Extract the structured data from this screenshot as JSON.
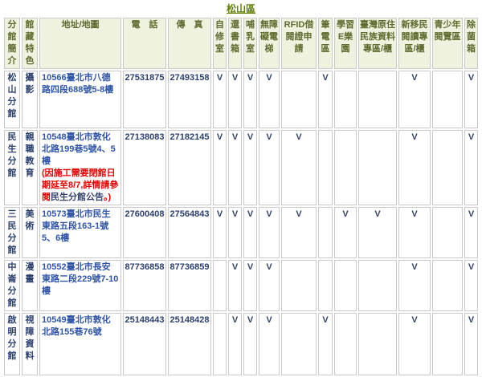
{
  "title": {
    "text": "松山區"
  },
  "colors": {
    "title_green": "#5e7d00",
    "header_bg": "#f0f2e0",
    "header_text": "#5d6b2e",
    "body_text_navy": "#2c406f",
    "address_link_blue": "#2f55a8",
    "notice_red": "#e60000",
    "grid_border": "#c9c9c9"
  },
  "table": {
    "headers": {
      "branch": "分館簡介",
      "feature": "館藏特色",
      "address": "地址/地圖",
      "phone": "電　話",
      "fax": "傳　真",
      "amenities": [
        "自修室",
        "還書箱",
        "哺乳室",
        "無障礙電梯",
        "RFID借閱證申請",
        "筆電區",
        "學習E樂園",
        "臺灣原住民族資料專區/櫃",
        "新移民閱讀專區/櫃",
        "青少年閱覽區",
        "除菌箱"
      ]
    },
    "rows": [
      {
        "branch": "松山分館",
        "feature": "攝影",
        "address": "10566臺北市八德路四段688號5-8樓",
        "phone": "27531875",
        "fax": "27493158",
        "marks": [
          "V",
          "V",
          "V",
          "V",
          "",
          "V",
          "",
          "",
          "V",
          "",
          "V"
        ]
      },
      {
        "branch": "民生分館",
        "feature": "親職教育",
        "address": "10548臺北市敦化北路199巷5號4、5樓",
        "note": {
          "prefix": "(因施工需要閉館日期延至8/7,詳情請參閱",
          "link": "民生分館公告",
          "suffix": "。)"
        },
        "phone": "27138083",
        "fax": "27182145",
        "marks": [
          "V",
          "V",
          "V",
          "V",
          "V",
          "",
          "",
          "",
          "V",
          "",
          "V"
        ]
      },
      {
        "branch": "三民分館",
        "feature": "美術",
        "address": "10573臺北市民生東路五段163-1號5、6樓",
        "phone": "27600408",
        "fax": "27564843",
        "marks": [
          "V",
          "V",
          "V",
          "V",
          "V",
          "",
          "V",
          "V",
          "V",
          "",
          "V"
        ]
      },
      {
        "branch": "中崙分館",
        "feature": "漫畫",
        "address": "10552臺北市長安東路二段229號7-10樓",
        "phone": "87736858",
        "fax": "87736859",
        "marks": [
          "",
          "V",
          "V",
          "V",
          "",
          "",
          "",
          "",
          "V",
          "",
          "V"
        ]
      },
      {
        "branch": "啟明分館",
        "feature": "視障資料",
        "address": "10549臺北市敦化北路155巷76號",
        "phone": "25148443",
        "fax": "25148428",
        "marks": [
          "",
          "V",
          "V",
          "V",
          "",
          "V",
          "",
          "",
          "V",
          "",
          "V"
        ]
      }
    ]
  }
}
